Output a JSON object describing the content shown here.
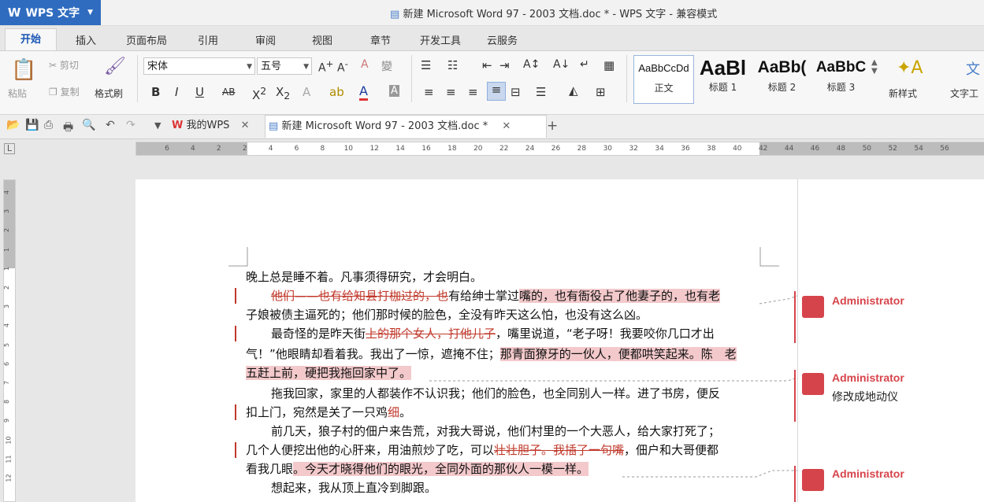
{
  "app": {
    "name": "WPS 文字",
    "window_title": "新建 Microsoft Word 97 - 2003 文档.doc * - WPS 文字 - 兼容模式"
  },
  "menu_tabs": [
    "开始",
    "插入",
    "页面布局",
    "引用",
    "审阅",
    "视图",
    "章节",
    "开发工具",
    "云服务"
  ],
  "ribbon": {
    "paste": "粘贴",
    "cut": "剪切",
    "copy": "复制",
    "format_painter": "格式刷",
    "font_name": "宋体",
    "font_size": "五号",
    "styles": [
      {
        "sample": "AaBbCcDd",
        "name": "正文"
      },
      {
        "sample": "AaBl",
        "name": "标题 1"
      },
      {
        "sample": "AaBb(",
        "name": "标题 2"
      },
      {
        "sample": "AaBbC",
        "name": "标题 3"
      }
    ],
    "new_style": "新样式",
    "text_tool": "文字工"
  },
  "doc_tabs": [
    {
      "label": "我的WPS"
    },
    {
      "label": "新建 Microsoft Word 97 - 2003 文档.doc *"
    }
  ],
  "ruler": {
    "h_ticks": [
      "6",
      "4",
      "2",
      "2",
      "4",
      "6",
      "8",
      "10",
      "12",
      "14",
      "16",
      "18",
      "20",
      "22",
      "24",
      "26",
      "28",
      "30",
      "32",
      "34",
      "36",
      "38",
      "40",
      "42",
      "44",
      "46",
      "48",
      "50",
      "52",
      "54",
      "56"
    ],
    "v_ticks": [
      "4",
      "3",
      "2",
      "1",
      "1",
      "2",
      "3",
      "4",
      "5",
      "6",
      "7",
      "8",
      "9",
      "10",
      "11",
      "12"
    ]
  },
  "document": {
    "l1": "晚上总是睡不着。凡事须得研究，才会明白。",
    "l2_del": "他们——也有给知县打枷过的，也",
    "l2_a": "有给绅士掌过",
    "l2_hl": "嘴的，也有衙役占了他妻子的，也有老",
    "l3": "子娘被债主逼死的；他们那时候的脸色，全没有昨天这么怕，也没有这么凶。",
    "l4_a": "最奇怪的是昨天街",
    "l4_del": "上的那个女人，打他儿子",
    "l4_b": "，嘴里说道，“老子呀！我要咬你几口才出",
    "l5_a": "气！”他眼睛却看着我。我出了一惊，遮掩不住；",
    "l5_hl": "那青面獠牙的一伙人，便都哄笑起来。陈　老",
    "l6_hl": "五赶上前，硬把我拖回家中了。",
    "l7": "拖我回家，家里的人都装作不认识我；他们的脸色，也全同别人一样。进了书房，便反",
    "l8_a": "扣上门，宛然是关了一只鸡",
    "l8_ins": "细",
    "l8_b": "。",
    "l9": "前几天，狼子村的佃户来告荒，对我大哥说，他们村里的一个大恶人，给大家打死了；",
    "l10_a": "几个人便挖出他的心肝来，用油煎炒了吃，可以",
    "l10_del": "壮壮胆子。我插了一句嘴",
    "l10_b": "，佃户和大哥便都",
    "l11_a": "看我几眼",
    "l11_hl": "。今天才晓得他们的眼光，全同外面的那伙人一模一样。",
    "l12": "想起来，我从顶上直冷到脚跟。"
  },
  "comments": [
    {
      "author": "Administrator",
      "text": ""
    },
    {
      "author": "Administrator",
      "text": "修改成地动仪"
    },
    {
      "author": "Administrator",
      "text": ""
    }
  ],
  "colors": {
    "accent": "#2f6cc0",
    "revision": "#c0392b",
    "highlight": "#f3c9cb",
    "comment": "#d6444b"
  }
}
